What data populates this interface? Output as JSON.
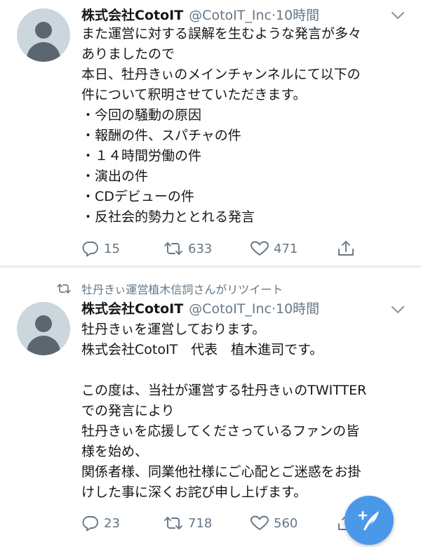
{
  "tweets": [
    {
      "display_name": "株式会社CotoIT",
      "handle": "@CotoIT_Inc",
      "separator": "·",
      "timestamp": "10時間",
      "text_lines": [
        "また運営に対する誤解を生むような発言が多々",
        "ありましたので",
        "本日、牡丹きぃのメインチャンネルにて以下の",
        "件について釈明させていただきます。",
        "・今回の騒動の原因",
        "・報酬の件、スパチャの件",
        "・１４時間労働の件",
        "・演出の件",
        "・CDデビューの件",
        "・反社会的勢力ととれる発言"
      ],
      "reply_count": "15",
      "retweet_count": "633",
      "like_count": "471"
    },
    {
      "retweet_context": "牡丹きぃ運営植木信詞さんがリツイート",
      "display_name": "株式会社CotoIT",
      "handle": "@CotoIT_Inc",
      "separator": "·",
      "timestamp": "10時間",
      "text_lines": [
        "牡丹きぃを運営しております。",
        "株式会社CotoIT　代表　植木進司です。",
        "",
        "この度は、当社が運営する牡丹きぃのTWITTER",
        "での発言により",
        "牡丹きぃを応援してくださっているファンの皆",
        "様を始め、",
        "関係者様、同業他社様にご心配とご迷惑をお掛",
        "けした事に深くお詫び申し上げます。"
      ],
      "reply_count": "23",
      "retweet_count": "718",
      "like_count": "560"
    }
  ],
  "icons": {
    "avatar": "default-avatar-icon",
    "menu": "chevron-down-icon",
    "reply": "reply-icon",
    "retweet": "retweet-icon",
    "like": "heart-icon",
    "share": "share-icon",
    "compose": "compose-tweet-icon"
  },
  "colors": {
    "text": "#14171a",
    "secondary": "#657786",
    "accent": "#4a99e9",
    "divider": "#e6ecf0",
    "avatar_bg": "#ccd6dd"
  }
}
